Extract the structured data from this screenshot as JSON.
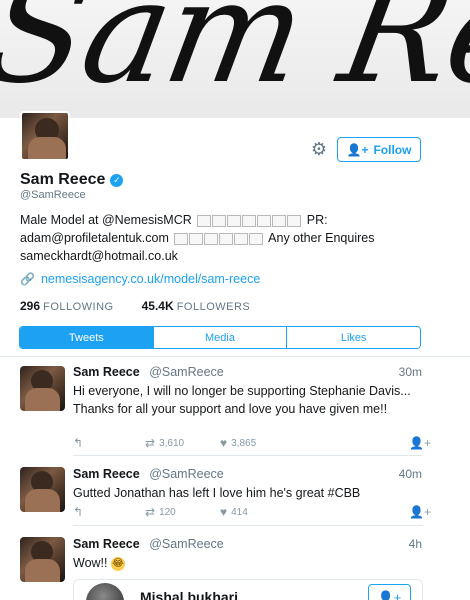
{
  "banner": {
    "text": "Sam Reece"
  },
  "profile": {
    "name": "Sam Reece",
    "handle": "@SamReece",
    "bio": {
      "line1_a": "Male Model at @NemesisMCR",
      "line1_b": "PR:",
      "line2_a": "adam@profiletalentuk.com",
      "line2_b": "Any other Enquires",
      "line3": "sameckhardt@hotmail.co.uk"
    },
    "website": "nemesisagency.co.uk/model/sam-reece",
    "stats": {
      "following_count": "296",
      "following_label": "FOLLOWING",
      "followers_count": "45.4K",
      "followers_label": "FOLLOWERS"
    },
    "follow_label": "Follow",
    "icons": {
      "settings": "gear-icon",
      "follow": "add-user-icon",
      "verified": "verified-badge-icon",
      "link": "link-icon"
    }
  },
  "tabs": [
    {
      "label": "Tweets",
      "active": true
    },
    {
      "label": "Media",
      "active": false
    },
    {
      "label": "Likes",
      "active": false
    }
  ],
  "tweets": [
    {
      "name": "Sam Reece",
      "handle": "@SamReece",
      "time": "30m",
      "text": "Hi everyone, I will no longer be supporting Stephanie Davis... Thanks for all your support and love you have given me!!",
      "retweets": "3,610",
      "likes": "3,865"
    },
    {
      "name": "Sam Reece",
      "handle": "@SamReece",
      "time": "40m",
      "text": "Gutted Jonathan has left I love him he's great #CBB",
      "retweets": "120",
      "likes": "414"
    },
    {
      "name": "Sam Reece",
      "handle": "@SamReece",
      "time": "4h",
      "text": "Wow!!",
      "emoji": "laughing-face"
    }
  ],
  "quote": {
    "name": "Mishal bukhari"
  },
  "colors": {
    "accent": "#1da1f2",
    "muted": "#657786",
    "text": "#14171a"
  }
}
